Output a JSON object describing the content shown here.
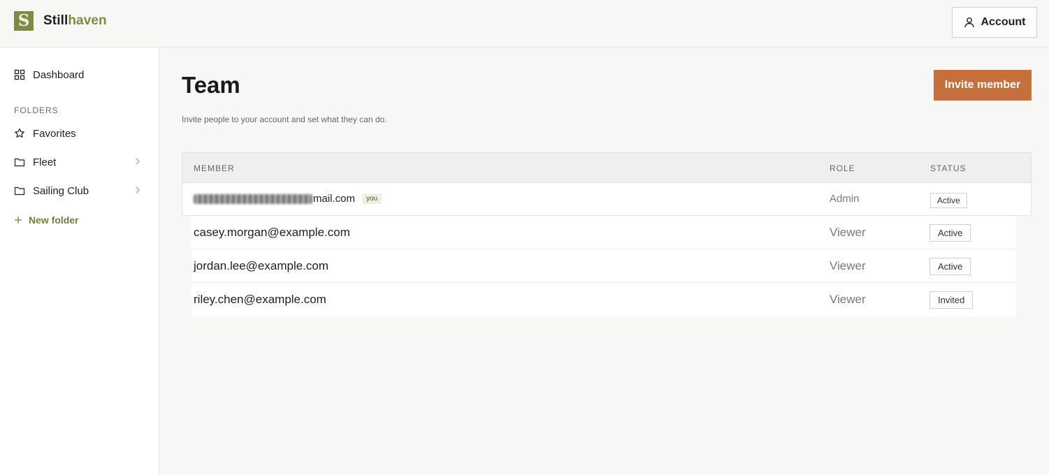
{
  "brand": {
    "name_part1": "Still",
    "name_part2": "haven",
    "logo_letter": "S",
    "color": "#7d8b45"
  },
  "header": {
    "account_label": "Account"
  },
  "sidebar": {
    "dashboard_label": "Dashboard",
    "folders_heading": "FOLDERS",
    "items": [
      {
        "label": "Favorites",
        "icon": "star-icon"
      },
      {
        "label": "Fleet",
        "icon": "folder-icon"
      },
      {
        "label": "Sailing Club",
        "icon": "folder-icon"
      }
    ],
    "new_folder_label": "New folder"
  },
  "main": {
    "title": "Team",
    "subtitle": "Invite people to your account and set what they can do.",
    "invite_label": "Invite member",
    "invite_color": "#c46f3c"
  },
  "table": {
    "headers": {
      "member": "MEMBER",
      "role": "ROLE",
      "status": "STATUS"
    },
    "current_user": {
      "email_visible": "mail.com",
      "you_tag": "you",
      "role": "Admin",
      "status": "Active"
    },
    "rows": [
      {
        "email": "casey.morgan@example.com",
        "role": "Viewer",
        "status": "Active"
      },
      {
        "email": "jordan.lee@example.com",
        "role": "Viewer",
        "status": "Active"
      },
      {
        "email": "riley.chen@example.com",
        "role": "Viewer",
        "status": "Invited"
      }
    ]
  }
}
